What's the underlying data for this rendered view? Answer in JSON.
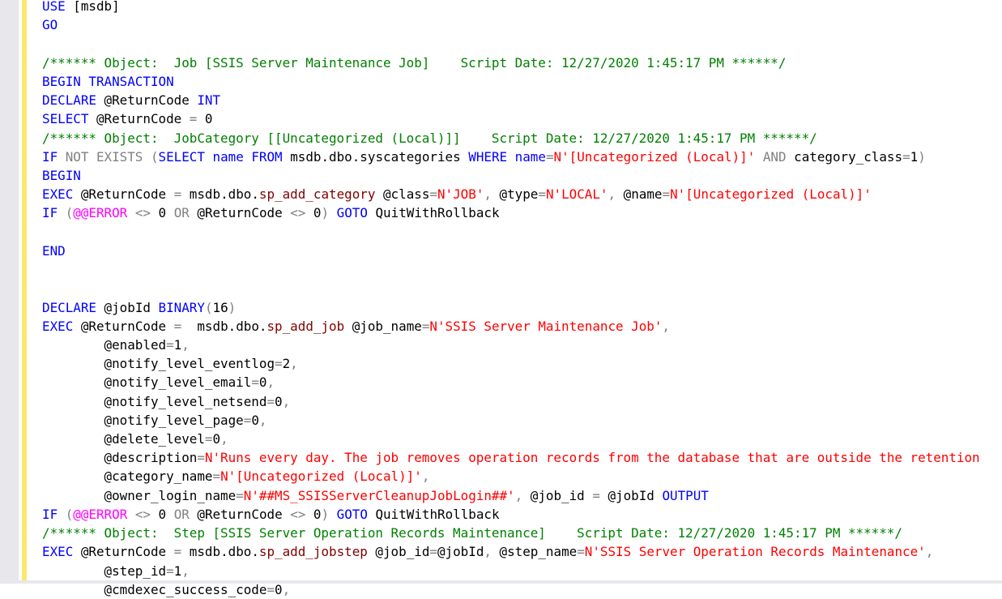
{
  "colors": {
    "keyword": "#0000ff",
    "comment": "#008000",
    "string": "#ff0000",
    "operator": "#808080",
    "function": "#800000",
    "system": "#ff00ff",
    "change_marker": "#fbe86b"
  },
  "editor": {
    "lines": [
      [
        [
          "USE",
          "k"
        ],
        [
          " [msdb]",
          "p"
        ]
      ],
      [
        [
          "GO",
          "k"
        ]
      ],
      [],
      [
        [
          "/****** Object:  Job [SSIS Server Maintenance Job]    Script Date: 12/27/2020 1:45:17 PM ******/",
          "c"
        ]
      ],
      [
        [
          "BEGIN TRANSACTION",
          "k"
        ]
      ],
      [
        [
          "DECLARE",
          "k"
        ],
        [
          " @ReturnCode ",
          "p"
        ],
        [
          "INT",
          "k"
        ]
      ],
      [
        [
          "SELECT",
          "k"
        ],
        [
          " @ReturnCode ",
          "p"
        ],
        [
          "=",
          "g"
        ],
        [
          " 0",
          "p"
        ]
      ],
      [
        [
          "/****** Object:  JobCategory [[Uncategorized (Local)]]    Script Date: 12/27/2020 1:45:17 PM ******/",
          "c"
        ]
      ],
      [
        [
          "IF",
          "k"
        ],
        [
          " NOT EXISTS (",
          "g"
        ],
        [
          "SELECT",
          "k"
        ],
        [
          " ",
          "p"
        ],
        [
          "name",
          "k"
        ],
        [
          " ",
          "p"
        ],
        [
          "FROM",
          "k"
        ],
        [
          " msdb.dbo.syscategories ",
          "p"
        ],
        [
          "WHERE",
          "k"
        ],
        [
          " ",
          "p"
        ],
        [
          "name",
          "k"
        ],
        [
          "=",
          "g"
        ],
        [
          "N'[Uncategorized (Local)]'",
          "s"
        ],
        [
          " AND ",
          "g"
        ],
        [
          "category_class",
          "p"
        ],
        [
          "=",
          "g"
        ],
        [
          "1",
          "p"
        ],
        [
          ")",
          "g"
        ]
      ],
      [
        [
          "BEGIN",
          "k"
        ]
      ],
      [
        [
          "EXEC",
          "k"
        ],
        [
          " @ReturnCode ",
          "p"
        ],
        [
          "=",
          "g"
        ],
        [
          " msdb.dbo.",
          "p"
        ],
        [
          "sp_add_category",
          "f"
        ],
        [
          " @class",
          "p"
        ],
        [
          "=",
          "g"
        ],
        [
          "N'JOB'",
          "s"
        ],
        [
          ", ",
          "g"
        ],
        [
          "@type",
          "p"
        ],
        [
          "=",
          "g"
        ],
        [
          "N'LOCAL'",
          "s"
        ],
        [
          ", ",
          "g"
        ],
        [
          "@name",
          "p"
        ],
        [
          "=",
          "g"
        ],
        [
          "N'[Uncategorized (Local)]'",
          "s"
        ]
      ],
      [
        [
          "IF",
          "k"
        ],
        [
          " (",
          "g"
        ],
        [
          "@@ERROR",
          "m"
        ],
        [
          " <> ",
          "g"
        ],
        [
          "0",
          "p"
        ],
        [
          " OR ",
          "g"
        ],
        [
          "@ReturnCode ",
          "p"
        ],
        [
          "<>",
          "g"
        ],
        [
          " 0",
          "p"
        ],
        [
          ") ",
          "g"
        ],
        [
          "GOTO",
          "k"
        ],
        [
          " QuitWithRollback",
          "p"
        ]
      ],
      [],
      [
        [
          "END",
          "k"
        ]
      ],
      [],
      [],
      [
        [
          "DECLARE",
          "k"
        ],
        [
          " @jobId ",
          "p"
        ],
        [
          "BINARY",
          "k"
        ],
        [
          "(",
          "g"
        ],
        [
          "16",
          "p"
        ],
        [
          ")",
          "g"
        ]
      ],
      [
        [
          "EXEC",
          "k"
        ],
        [
          " @ReturnCode ",
          "p"
        ],
        [
          "=",
          "g"
        ],
        [
          "  msdb.dbo.",
          "p"
        ],
        [
          "sp_add_job",
          "f"
        ],
        [
          " @job_name",
          "p"
        ],
        [
          "=",
          "g"
        ],
        [
          "N'SSIS Server Maintenance Job'",
          "s"
        ],
        [
          ",",
          "g"
        ]
      ],
      [
        [
          "        @enabled",
          "p"
        ],
        [
          "=",
          "g"
        ],
        [
          "1",
          "p"
        ],
        [
          ",",
          "g"
        ]
      ],
      [
        [
          "        @notify_level_eventlog",
          "p"
        ],
        [
          "=",
          "g"
        ],
        [
          "2",
          "p"
        ],
        [
          ",",
          "g"
        ]
      ],
      [
        [
          "        @notify_level_email",
          "p"
        ],
        [
          "=",
          "g"
        ],
        [
          "0",
          "p"
        ],
        [
          ",",
          "g"
        ]
      ],
      [
        [
          "        @notify_level_netsend",
          "p"
        ],
        [
          "=",
          "g"
        ],
        [
          "0",
          "p"
        ],
        [
          ",",
          "g"
        ]
      ],
      [
        [
          "        @notify_level_page",
          "p"
        ],
        [
          "=",
          "g"
        ],
        [
          "0",
          "p"
        ],
        [
          ",",
          "g"
        ]
      ],
      [
        [
          "        @delete_level",
          "p"
        ],
        [
          "=",
          "g"
        ],
        [
          "0",
          "p"
        ],
        [
          ",",
          "g"
        ]
      ],
      [
        [
          "        @description",
          "p"
        ],
        [
          "=",
          "g"
        ],
        [
          "N'Runs every day. The job removes operation records from the database that are outside the retention",
          "s"
        ]
      ],
      [
        [
          "        @category_name",
          "p"
        ],
        [
          "=",
          "g"
        ],
        [
          "N'[Uncategorized (Local)]'",
          "s"
        ],
        [
          ",",
          "g"
        ]
      ],
      [
        [
          "        @owner_login_name",
          "p"
        ],
        [
          "=",
          "g"
        ],
        [
          "N'##MS_SSISServerCleanupJobLogin##'",
          "s"
        ],
        [
          ", ",
          "g"
        ],
        [
          "@job_id ",
          "p"
        ],
        [
          "=",
          "g"
        ],
        [
          " @jobId ",
          "p"
        ],
        [
          "OUTPUT",
          "k"
        ]
      ],
      [
        [
          "IF",
          "k"
        ],
        [
          " (",
          "g"
        ],
        [
          "@@ERROR",
          "m"
        ],
        [
          " <> ",
          "g"
        ],
        [
          "0",
          "p"
        ],
        [
          " OR ",
          "g"
        ],
        [
          "@ReturnCode ",
          "p"
        ],
        [
          "<>",
          "g"
        ],
        [
          " 0",
          "p"
        ],
        [
          ") ",
          "g"
        ],
        [
          "GOTO",
          "k"
        ],
        [
          " QuitWithRollback",
          "p"
        ]
      ],
      [
        [
          "/****** Object:  Step [SSIS Server Operation Records Maintenance]    Script Date: 12/27/2020 1:45:17 PM ******/",
          "c"
        ]
      ],
      [
        [
          "EXEC",
          "k"
        ],
        [
          " @ReturnCode ",
          "p"
        ],
        [
          "=",
          "g"
        ],
        [
          " msdb.dbo.",
          "p"
        ],
        [
          "sp_add_jobstep",
          "f"
        ],
        [
          " @job_id",
          "p"
        ],
        [
          "=",
          "g"
        ],
        [
          "@jobId",
          ""
        ],
        [
          ", ",
          "g"
        ],
        [
          "@step_name",
          "p"
        ],
        [
          "=",
          "g"
        ],
        [
          "N'SSIS Server Operation Records Maintenance'",
          "s"
        ],
        [
          ",",
          "g"
        ]
      ],
      [
        [
          "        @step_id",
          "p"
        ],
        [
          "=",
          "g"
        ],
        [
          "1",
          "p"
        ],
        [
          ",",
          "g"
        ]
      ],
      [
        [
          "        @cmdexec_success_code",
          "p"
        ],
        [
          "=",
          "g"
        ],
        [
          "0",
          "p"
        ],
        [
          ",",
          "g"
        ]
      ]
    ]
  }
}
